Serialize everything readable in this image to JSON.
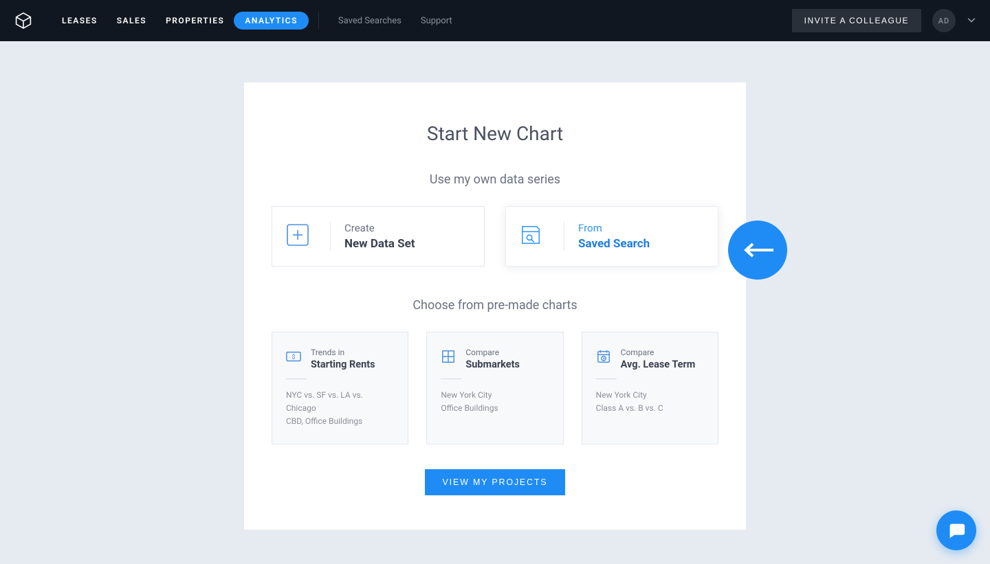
{
  "nav": {
    "links": [
      "LEASES",
      "SALES",
      "PROPERTIES",
      "ANALYTICS"
    ],
    "active_index": 3,
    "secondary": [
      "Saved Searches",
      "Support"
    ],
    "invite_label": "INVITE A COLLEAGUE",
    "avatar_initials": "AD"
  },
  "card": {
    "title": "Start New Chart",
    "section1_title": "Use my own data series",
    "option_create": {
      "top": "Create",
      "bottom": "New Data Set"
    },
    "option_saved": {
      "top": "From",
      "bottom": "Saved Search"
    },
    "section2_title": "Choose from pre-made charts",
    "premade": [
      {
        "top": "Trends in",
        "bottom": "Starting Rents",
        "desc1": "NYC vs. SF vs. LA vs. Chicago",
        "desc2": "CBD, Office Buildings"
      },
      {
        "top": "Compare",
        "bottom": "Submarkets",
        "desc1": "New York City",
        "desc2": "Office Buildings"
      },
      {
        "top": "Compare",
        "bottom": "Avg. Lease Term",
        "desc1": "New York City",
        "desc2": "Class A vs. B vs. C"
      }
    ],
    "cta_label": "VIEW MY PROJECTS"
  },
  "colors": {
    "accent": "#1f8cf5"
  }
}
